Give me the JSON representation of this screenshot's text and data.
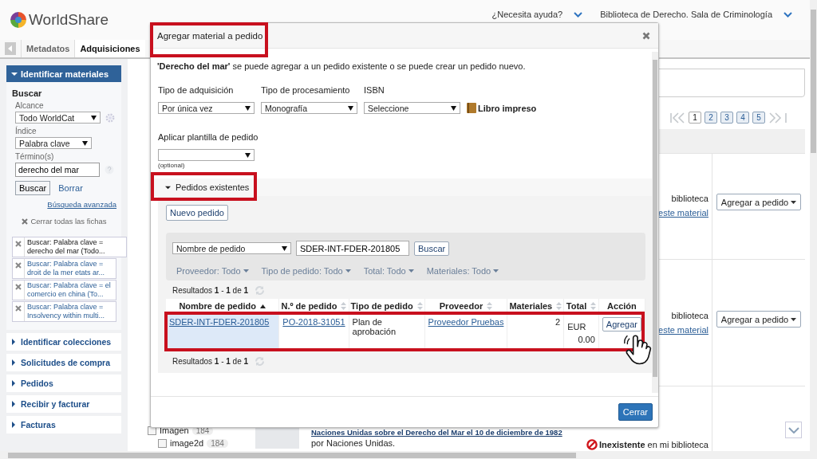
{
  "header": {
    "logo": "WorldShare",
    "help": "¿Necesita ayuda?",
    "library": "Biblioteca de Derecho. Sala de Criminología"
  },
  "module_tabs": [
    {
      "label": "Metadatos",
      "selected": false
    },
    {
      "label": "Adquisiciones",
      "selected": true
    }
  ],
  "sidebar": {
    "active_section": {
      "title": "Identificar materiales",
      "expanded": true
    },
    "search": {
      "heading": "Buscar",
      "scope": {
        "label": "Alcance",
        "value": "Todo WorldCat"
      },
      "index": {
        "label": "Índice",
        "value": "Palabra clave"
      },
      "term": {
        "label": "Término(s)",
        "value": "derecho del mar"
      },
      "search_button": "Buscar",
      "clear_link": "Borrar",
      "advanced_link": "Búsqueda avanzada",
      "close_all": "Cerrar todas las fichas"
    },
    "history": [
      {
        "text": "Buscar: Palabra clave =\nderecho del mar (Todo...",
        "selected": true
      },
      {
        "text": "Buscar: Palabra clave =\ndroit de la mer etats ar...",
        "selected": false
      },
      {
        "text": "Buscar: Palabra clave = el\ncomercio en china (To...",
        "selected": false
      },
      {
        "text": "Buscar: Palabra clave =\nInsolvency within multi...",
        "selected": false
      }
    ],
    "sections": [
      {
        "title": "Identificar colecciones",
        "expanded": false
      },
      {
        "title": "Solicitudes de compra",
        "expanded": false
      },
      {
        "title": "Pedidos",
        "expanded": false
      },
      {
        "title": "Recibir y facturar",
        "expanded": false
      },
      {
        "title": "Facturas",
        "expanded": false
      }
    ]
  },
  "pagination": [
    {
      "label": "1",
      "selected": true
    },
    {
      "label": "2",
      "selected": false
    },
    {
      "label": "3",
      "selected": false
    },
    {
      "label": "4",
      "selected": false
    },
    {
      "label": "5",
      "selected": false
    }
  ],
  "facets": [
    {
      "label": "Imagen",
      "count": "184",
      "checked": false
    },
    {
      "label": "image2d",
      "count": "184",
      "checked": false
    }
  ],
  "results": [
    {
      "availability": "biblioteca",
      "link": "este material",
      "action": "Agregar a pedido"
    },
    {
      "availability": "biblioteca",
      "link": "este material",
      "action": "Agregar a pedido"
    },
    {
      "title": "Naciones Unidas sobre el Derecho del Mar el 10 de diciembre de 1982",
      "author": "por Naciones Unidas.",
      "availability": "**Inexistente** en mi biblioteca",
      "available": false
    }
  ],
  "dialog": {
    "title": "Agregar material a pedido",
    "title_highlighted": true,
    "message": "**'Derecho del mar'** se puede agregar a un pedido existente o se puede crear un pedido nuevo.",
    "fields": [
      {
        "label": "Tipo de adquisición",
        "value": "Por única vez"
      },
      {
        "label": "Tipo de procesamiento",
        "value": "Monografía"
      },
      {
        "label": "ISBN",
        "value": "Seleccione"
      }
    ],
    "format": "Libro impreso",
    "template": {
      "label": "Aplicar plantilla de pedido",
      "hint": "(optional)"
    },
    "section": {
      "title": "Pedidos existentes",
      "expanded": true,
      "highlighted": true
    },
    "new_order_button": "Nuevo pedido",
    "search": {
      "field": "Nombre de pedido",
      "value": "SDER-INT-FDER-201805",
      "button": "Buscar"
    },
    "filters": [
      "Proveedor: Todo",
      "Tipo de pedido: Todo",
      "Total: Todo",
      "Materiales: Todo"
    ],
    "results_top": "Resultados **1** - **1** de **1**",
    "table": {
      "columns": [
        {
          "label": "Nombre de pedido",
          "sortable": true,
          "sorted": true
        },
        {
          "label": "N.º de pedido",
          "sortable": true,
          "sorted": false
        },
        {
          "label": "Tipo de pedido",
          "sortable": true,
          "sorted": false
        },
        {
          "label": "Proveedor",
          "sortable": true,
          "sorted": false
        },
        {
          "label": "Materiales",
          "sortable": true,
          "sorted": false
        },
        {
          "label": "Total",
          "sortable": true,
          "sorted": false
        },
        {
          "label": "Acción",
          "sortable": false
        }
      ],
      "rows": [
        {
          "name": "SDER-INT-FDER-201805",
          "number": "PO-2018-31051",
          "type": "Plan de aprobación",
          "supplier": "Proveedor Pruebas",
          "items": "2",
          "currency": "EUR",
          "total": "0.00",
          "action": "Agregar",
          "selected": true,
          "highlighted": true
        }
      ]
    },
    "results_bottom": "Resultados **1** - **1** de **1**",
    "close_button": "Cerrar"
  }
}
